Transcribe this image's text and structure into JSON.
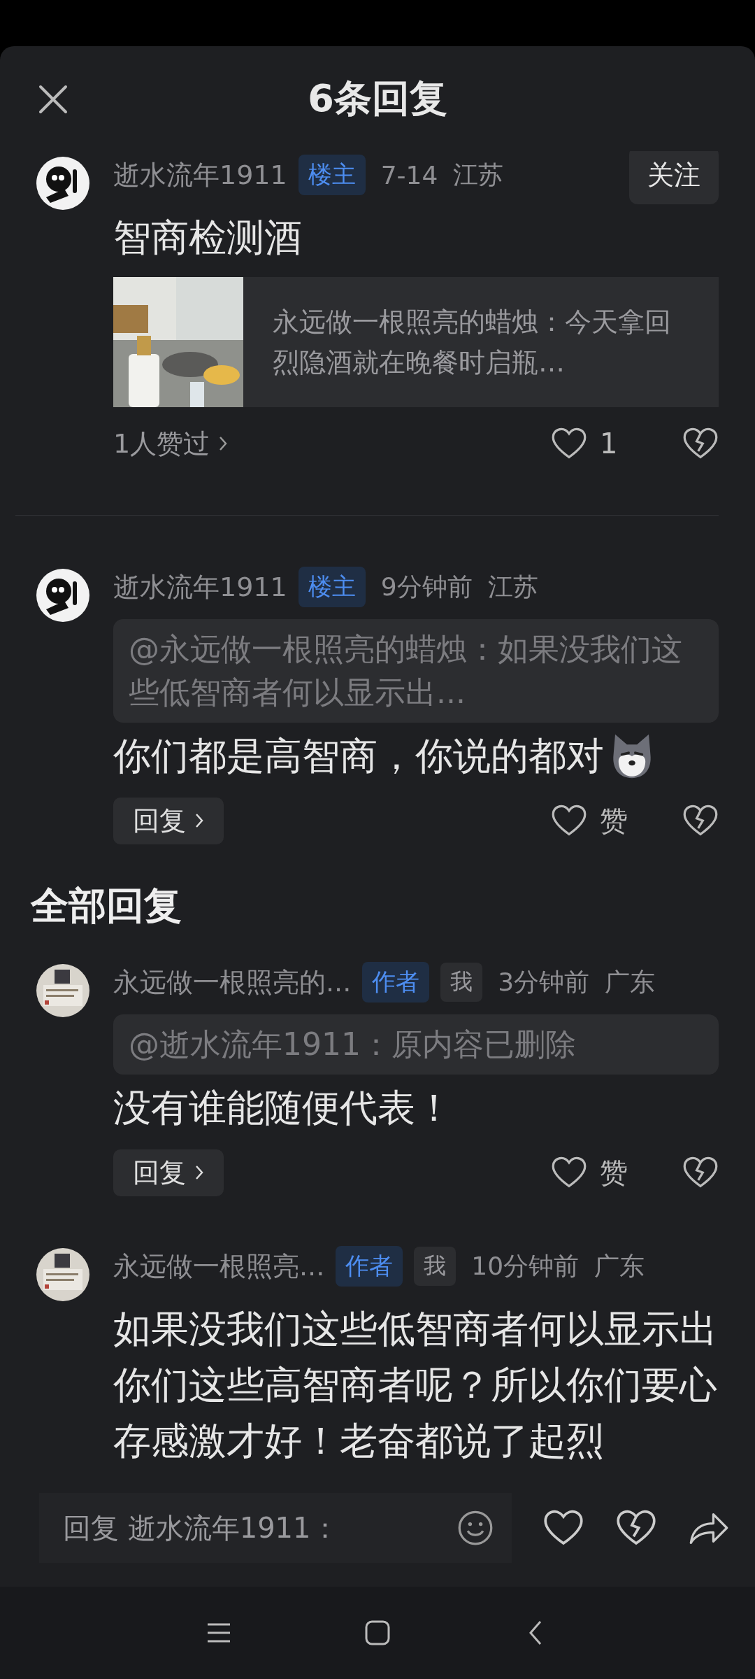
{
  "header": {
    "title": "6条回复"
  },
  "top_comments": [
    {
      "avatar": {
        "kind": "cartoon"
      },
      "name": "逝水流年1911",
      "tags": [
        {
          "label": "楼主",
          "kind": "op"
        }
      ],
      "time": "7-14",
      "location": "江苏",
      "follow": "关注",
      "text": "智商检测酒",
      "card": {
        "kind": "picture",
        "text": "永远做一根照亮的蜡烛：今天拿回烈隐酒就在晚餐时启瓶…"
      },
      "likes_summary": "1人赞过",
      "like_label": "1"
    },
    {
      "avatar": {
        "kind": "cartoon"
      },
      "name": "逝水流年1911",
      "tags": [
        {
          "label": "楼主",
          "kind": "op"
        }
      ],
      "time": "9分钟前",
      "location": "江苏",
      "quote": "@永远做一根照亮的蜡烛：如果没我们这些低智商者何以显示出...",
      "text": "你们都是高智商，你说的都对",
      "sticker": {
        "kind": "dog"
      },
      "reply": "回复",
      "like_label": "赞"
    }
  ],
  "section_title": "全部回复",
  "replies": [
    {
      "name": "永远做一根照亮的...",
      "tags": [
        {
          "label": "作者",
          "kind": "author"
        },
        {
          "label": "我",
          "kind": "me"
        }
      ],
      "time": "3分钟前",
      "location": "广东",
      "quote": "@逝水流年1911：原内容已删除",
      "text": "没有谁能随便代表！",
      "reply": "回复",
      "like_label": "赞"
    },
    {
      "name": "永远做一根照亮...",
      "tags": [
        {
          "label": "作者",
          "kind": "author"
        },
        {
          "label": "我",
          "kind": "me"
        }
      ],
      "time": "10分钟前",
      "location": "广东",
      "text": "如果没我们这些低智商者何以显示出你们这些高智商者呢？所以你们要心存感激才好！老奋都说了起烈"
    }
  ],
  "reply_bar": {
    "placeholder": "回复 逝水流年1911："
  }
}
